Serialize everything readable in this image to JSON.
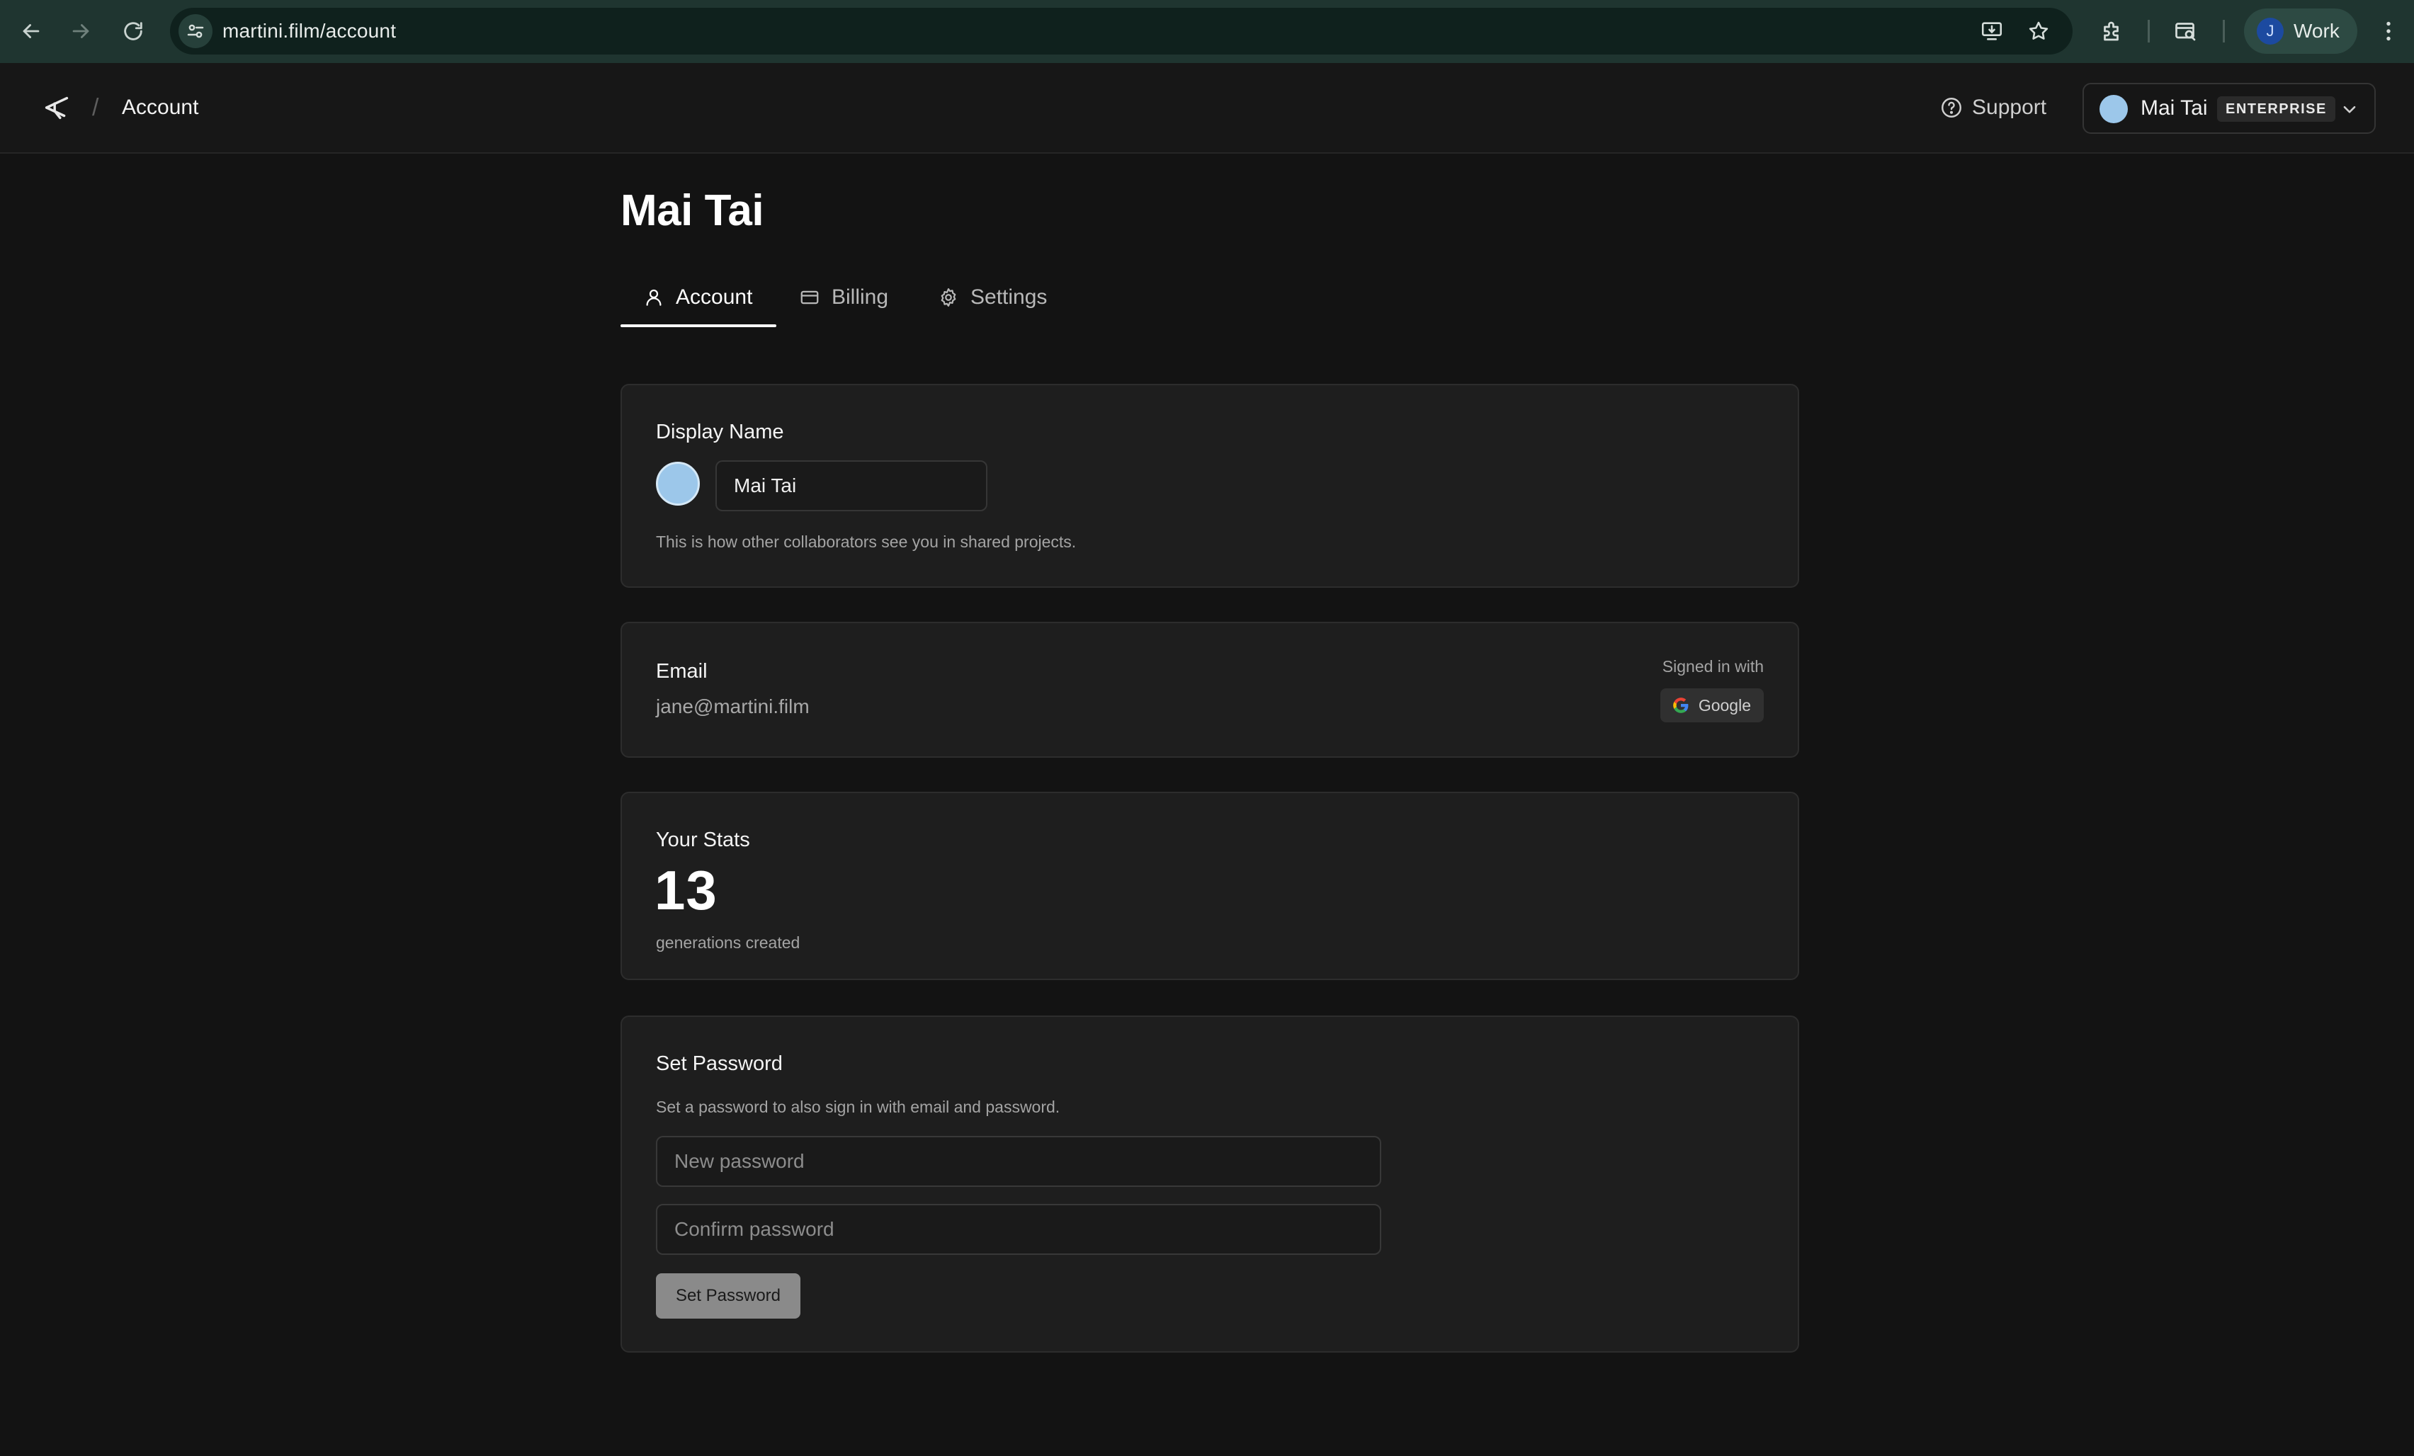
{
  "browser": {
    "url": "martini.film/account",
    "profile_initial": "J",
    "profile_label": "Work"
  },
  "header": {
    "breadcrumb_separator": "/",
    "breadcrumb": "Account",
    "support_label": "Support",
    "account_name": "Mai Tai",
    "account_tier": "ENTERPRISE"
  },
  "page": {
    "title": "Mai Tai",
    "tabs": [
      {
        "label": "Account",
        "icon": "user-icon",
        "active": true
      },
      {
        "label": "Billing",
        "icon": "credit-card-icon",
        "active": false
      },
      {
        "label": "Settings",
        "icon": "gear-icon",
        "active": false
      }
    ]
  },
  "display_name": {
    "title": "Display Name",
    "value": "Mai Tai",
    "help": "This is how other collaborators see you in shared projects."
  },
  "email": {
    "title": "Email",
    "value": "jane@martini.film",
    "signed_in_label": "Signed in with",
    "provider": "Google"
  },
  "stats": {
    "title": "Your Stats",
    "count": "13",
    "label": "generations created"
  },
  "password": {
    "title": "Set Password",
    "help": "Set a password to also sign in with email and password.",
    "new_placeholder": "New password",
    "confirm_placeholder": "Confirm password",
    "button_label": "Set Password"
  },
  "colors": {
    "background": "#131313",
    "card": "#1e1e1e",
    "avatar": "#9cc7ea",
    "chrome": "#1f3530"
  }
}
